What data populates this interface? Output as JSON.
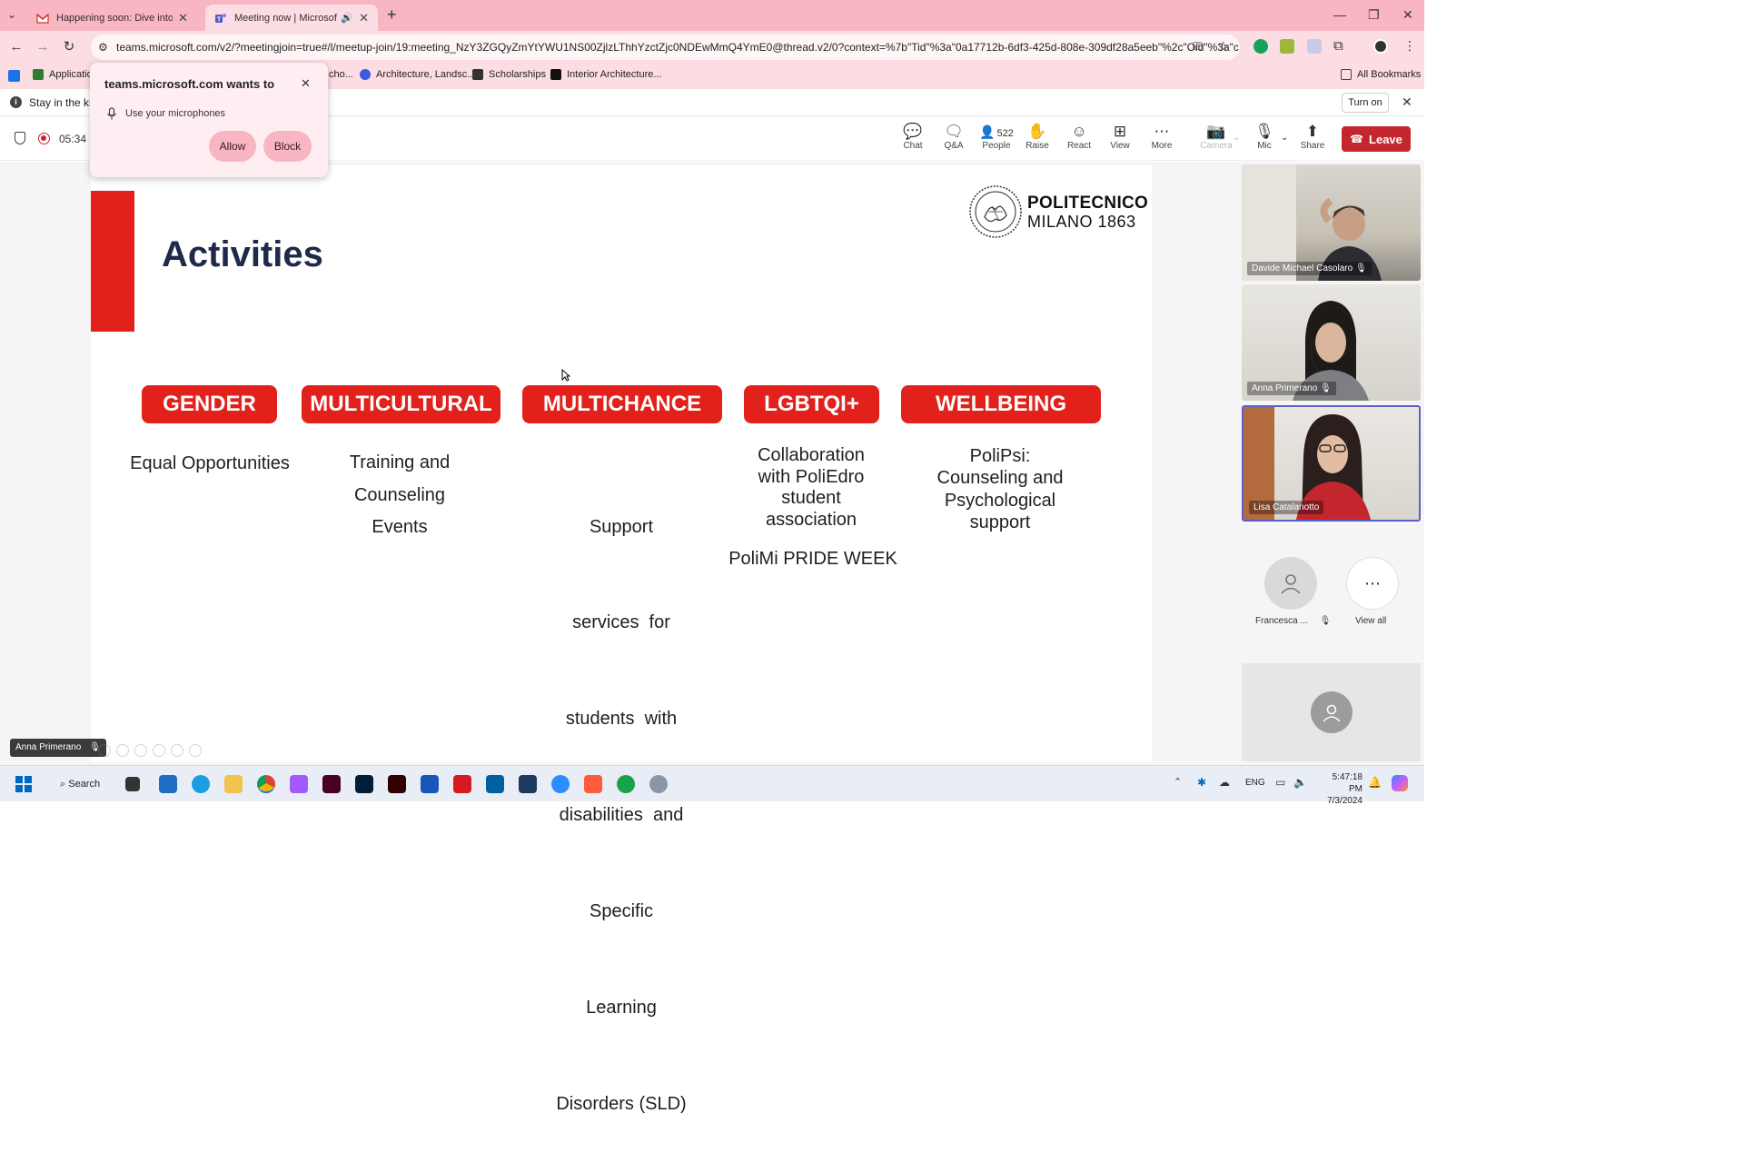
{
  "browser": {
    "tabs": [
      {
        "title": "Happening soon: Dive into Cam",
        "active": false
      },
      {
        "title": "Meeting now | Microsoft Te",
        "active": true
      }
    ],
    "url": "teams.microsoft.com/v2/?meetingjoin=true#/l/meetup-join/19:meeting_NzY3ZGQyZmYtYWU1NS00ZjlzLThhYzctZjc0NDEwMmQ4YmE0@thread.v2/0?context=%7b\"Tid\"%3a\"0a17712b-6df3-425d-808e-309df28a5eeb\"%2c\"Oid\"%3a\"c...",
    "bookmarks": [
      "Applicatio",
      "cho...",
      "Architecture, Landsc...",
      "Scholarships",
      "Interior Architecture..."
    ],
    "all_bookmarks": "All Bookmarks"
  },
  "infobar": {
    "text": "Stay in the kn",
    "turn_on": "Turn on"
  },
  "permission": {
    "title": "teams.microsoft.com wants to",
    "item": "Use your microphones",
    "allow": "Allow",
    "block": "Block"
  },
  "meeting": {
    "timer": "05:34",
    "tools": {
      "chat": "Chat",
      "qa": "Q&A",
      "people": "People",
      "people_count": "522",
      "raise": "Raise",
      "react": "React",
      "view": "View",
      "more": "More",
      "camera": "Camera",
      "mic": "Mic",
      "share": "Share"
    },
    "leave": "Leave"
  },
  "slide": {
    "title": "Activities",
    "logo_lines": [
      "POLITECNICO",
      "MILANO 1863"
    ],
    "categories": [
      {
        "label": "GENDER",
        "desc": [
          "Equal Opportunities"
        ]
      },
      {
        "label": "MULTICULTURAL",
        "desc": [
          "Training and",
          "Counseling",
          "Events"
        ]
      },
      {
        "label": "MULTICHANCE",
        "desc": [
          "Support",
          "services  for",
          "students  with",
          "disabilities  and",
          "Specific",
          "Learning",
          "Disorders (SLD)"
        ]
      },
      {
        "label": "LGBTQI+",
        "desc": [
          "Collaboration",
          "with PoliEdro",
          "student",
          "association"
        ],
        "extra": "PoliMi PRIDE WEEK"
      },
      {
        "label": "WELLBEING",
        "desc": [
          "PoliPsi:",
          "Counseling and",
          "Psychological",
          "support"
        ]
      }
    ]
  },
  "participants": [
    {
      "name": "Davide Michael Casolaro"
    },
    {
      "name": "Anna Primerano"
    },
    {
      "name": "Lisa Catalanotto"
    }
  ],
  "small_participants": {
    "name": "Francesca ...",
    "view_all": "View all"
  },
  "presenter_label": "Anna Primerano",
  "taskbar": {
    "search": "Search",
    "lang": "ENG",
    "time": "5:47:18 PM",
    "date": "7/3/2024"
  },
  "colors": {
    "accent_red": "#e2211c",
    "chrome_pink": "#f7b6c2",
    "leave_red": "#c4262e",
    "title_navy": "#1e2a4a"
  }
}
